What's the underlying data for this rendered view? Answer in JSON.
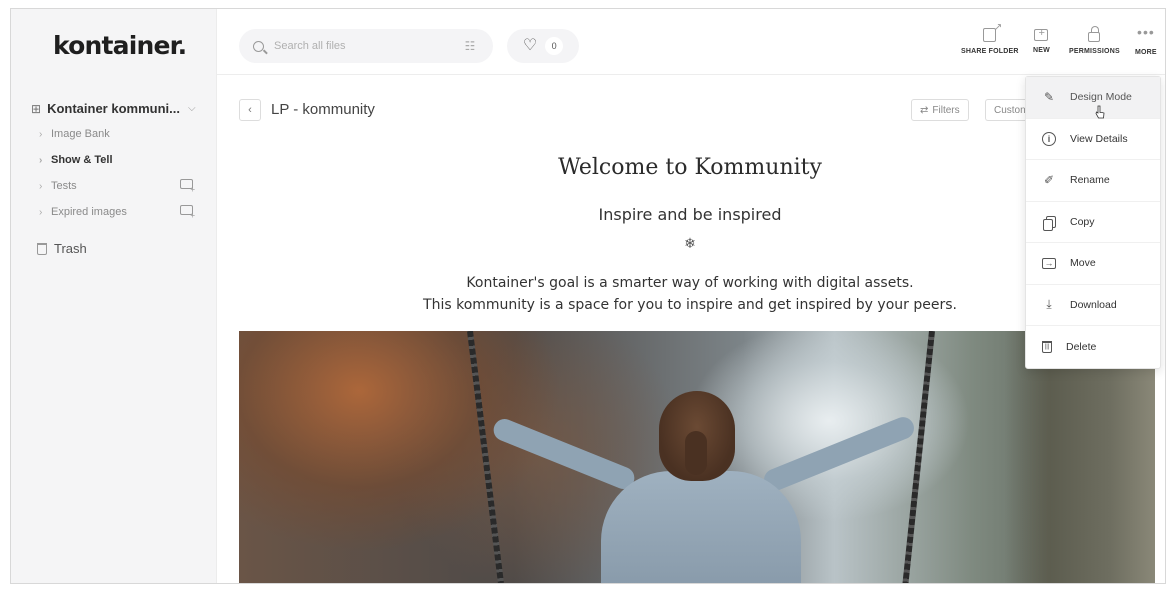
{
  "brand": {
    "logo": "kontainer."
  },
  "search": {
    "placeholder": "Search all files"
  },
  "likes": {
    "count": "0"
  },
  "toolbar": {
    "share_folder": "SHARE FOLDER",
    "new": "NEW",
    "permissions": "PERMISSIONS",
    "more": "MORE"
  },
  "sidebar": {
    "workspace": "Kontainer kommuni...",
    "items": [
      {
        "label": "Image Bank",
        "bold": false
      },
      {
        "label": "Show & Tell",
        "bold": true
      },
      {
        "label": "Tests",
        "bold": false
      },
      {
        "label": "Expired images",
        "bold": false
      }
    ],
    "trash": "Trash"
  },
  "main": {
    "breadcrumb": "LP - kommunity",
    "filters": "Filters",
    "custom": "Custon",
    "title": "Welcome to Kommunity",
    "tagline": "Inspire and be inspired",
    "divider": "❄",
    "body_line1": "Kontainer's goal is a smarter way of working with digital assets.",
    "body_line2": "This kommunity is a space for you to inspire and get inspired by your peers."
  },
  "menu": {
    "items": [
      {
        "label": "Design Mode",
        "icon": "pencil-icon"
      },
      {
        "label": "View Details",
        "icon": "info-icon"
      },
      {
        "label": "Rename",
        "icon": "rename-pen-icon"
      },
      {
        "label": "Copy",
        "icon": "copy-icon"
      },
      {
        "label": "Move",
        "icon": "move-icon"
      },
      {
        "label": "Download",
        "icon": "download-icon"
      },
      {
        "label": "Delete",
        "icon": "trash-icon"
      }
    ]
  }
}
